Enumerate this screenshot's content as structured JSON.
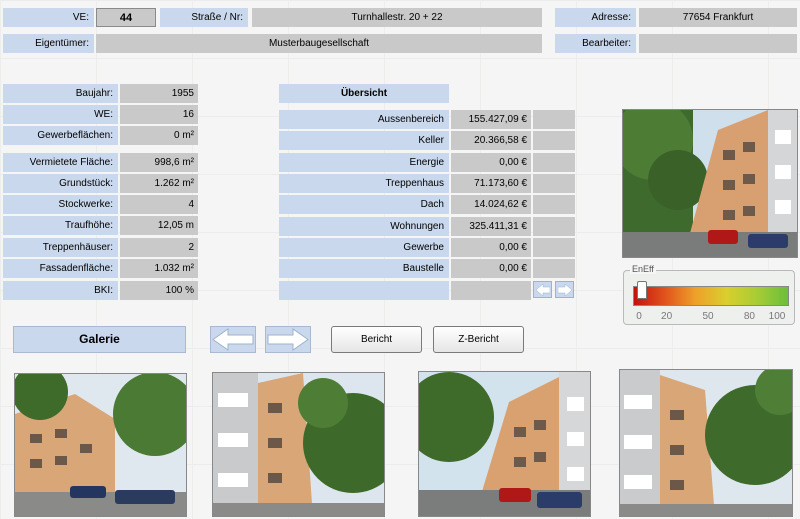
{
  "header": {
    "ve_label": "VE:",
    "ve_value": "44",
    "strasse_label": "Straße / Nr:",
    "strasse_value": "Turnhallestr. 20 + 22",
    "adresse_label": "Adresse:",
    "adresse_value": "77654 Frankfurt",
    "eigentuemer_label": "Eigentümer:",
    "eigentuemer_value": "Musterbaugesellschaft",
    "bearbeiter_label": "Bearbeiter:",
    "bearbeiter_value": ""
  },
  "details": [
    {
      "label": "Baujahr:",
      "value": "1955"
    },
    {
      "label": "WE:",
      "value": "16"
    },
    {
      "label": "Gewerbeflächen:",
      "value": "0 m²"
    },
    {
      "label": "Vermietete Fläche:",
      "value": "998,6 m²"
    },
    {
      "label": "Grundstück:",
      "value": "1.262 m²"
    },
    {
      "label": "Stockwerke:",
      "value": "4"
    },
    {
      "label": "Traufhöhe:",
      "value": "12,05 m"
    },
    {
      "label": "Treppenhäuser:",
      "value": "2"
    },
    {
      "label": "Fassadenfläche:",
      "value": "1.032 m²"
    },
    {
      "label": "BKI:",
      "value": "100 %"
    }
  ],
  "uebersicht": {
    "title": "Übersicht",
    "rows": [
      {
        "label": "Aussenbereich",
        "value": "155.427,09 €"
      },
      {
        "label": "Keller",
        "value": "20.366,58 €"
      },
      {
        "label": "Energie",
        "value": "0,00 €"
      },
      {
        "label": "Treppenhaus",
        "value": "71.173,60 €"
      },
      {
        "label": "Dach",
        "value": "14.024,62 €"
      },
      {
        "label": "Wohnungen",
        "value": "325.411,31 €"
      },
      {
        "label": "Gewerbe",
        "value": "0,00 €"
      },
      {
        "label": "Baustelle",
        "value": "0,00 €"
      }
    ]
  },
  "eneff": {
    "title": "EnEff",
    "ticks": [
      "0",
      "20",
      "50",
      "80",
      "100"
    ],
    "level": 0.02,
    "colors": [
      "#c4120e",
      "#eea02a",
      "#6bbf3b"
    ]
  },
  "gallery": {
    "title": "Galerie",
    "photo_count": 4
  },
  "buttons": {
    "bericht": "Bericht",
    "z_bericht": "Z-Bericht"
  },
  "icons": {
    "prev": "arrow-left-icon",
    "next": "arrow-right-icon"
  },
  "accent": "#c9d8ec",
  "value_bg": "#c9c9c9"
}
